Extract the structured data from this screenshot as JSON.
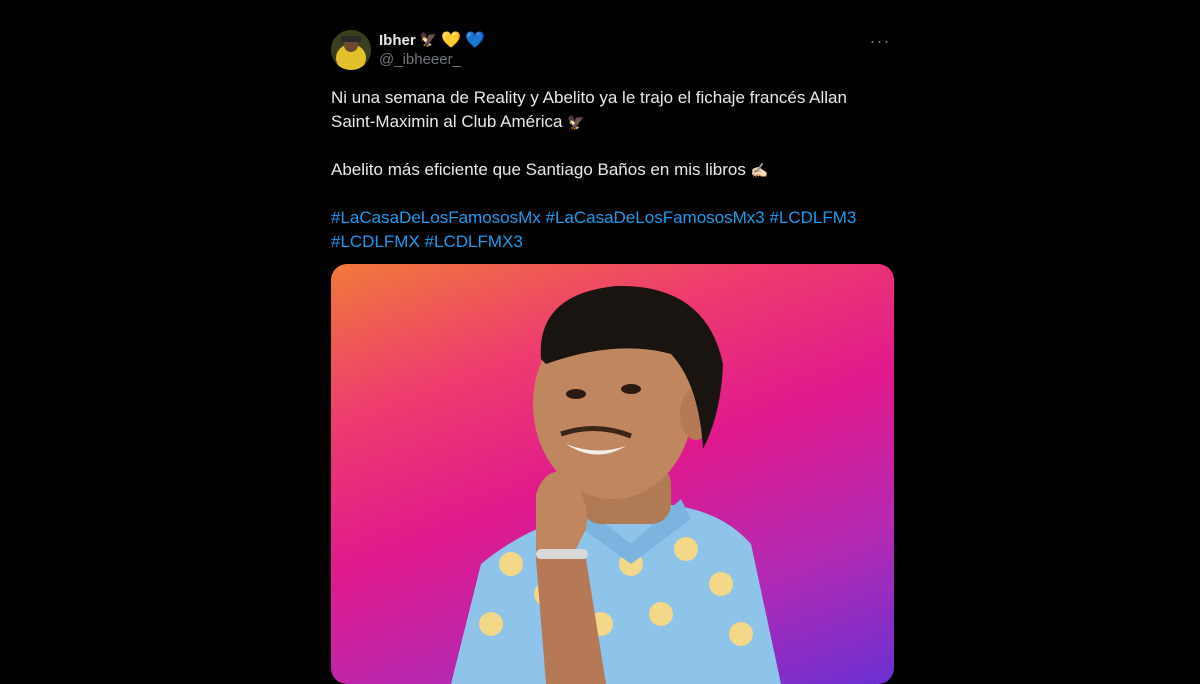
{
  "tweet": {
    "author": {
      "display_name": "Ibher",
      "emojis": [
        "🦅",
        "💛",
        "💙"
      ],
      "handle": "@_ibheeer_"
    },
    "more_label": "···",
    "paragraph1": {
      "text": "Ni una semana de Reality y Abelito ya le trajo el fichaje francés Allan Saint-Maximin al Club América",
      "emoji": "🦅"
    },
    "paragraph2": {
      "text": "Abelito más eficiente que Santiago Baños en mis libros",
      "emoji": "✍🏻"
    },
    "hashtags": [
      "#LaCasaDeLosFamososMx",
      "#LaCasaDeLosFamososMx3",
      "#LCDLFM3",
      "#LCDLFMX",
      "#LCDLFMX3"
    ]
  },
  "colors": {
    "background": "#000000",
    "text": "#e7e9ea",
    "secondary_text": "#71767b",
    "hashtag": "#1d9bf0"
  },
  "icons": {
    "more": "more-horizontal-icon"
  }
}
